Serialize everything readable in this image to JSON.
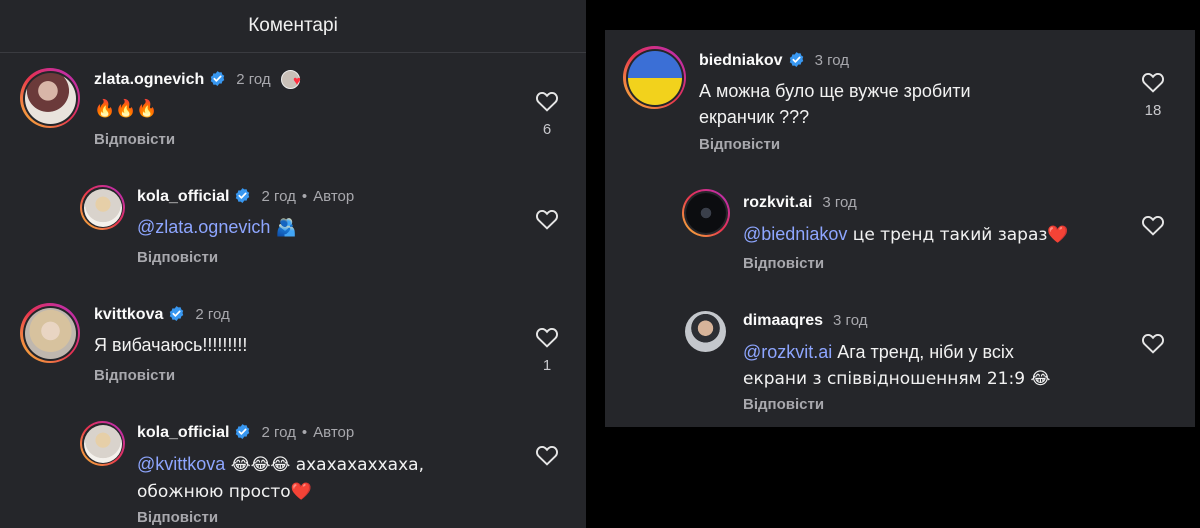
{
  "left": {
    "header_title": "Коментарі",
    "comments": [
      {
        "user": "zlata.ognevich",
        "time": "2 год",
        "text": "🔥🔥🔥",
        "reply": "Відповісти",
        "likes": "6"
      },
      {
        "user": "kola_official",
        "time": "2 год",
        "author": "Автор",
        "mention": "@zlata.ognevich",
        "text": " 🫂",
        "reply": "Відповісти"
      },
      {
        "user": "kvittkova",
        "time": "2 год",
        "text": "Я вибачаюсь!!!!!!!!!",
        "reply": "Відповісти",
        "likes": "1"
      },
      {
        "user": "kola_official",
        "time": "2 год",
        "author": "Автор",
        "mention": "@kvittkova",
        "text": " 😂😂😂 ахахахаххаха,",
        "text2": "обожнюю просто❤️",
        "reply": "Відповісти"
      }
    ]
  },
  "right": {
    "comments": [
      {
        "user": "biedniakov",
        "time": "3 год",
        "text": "А можна було ще вужче зробити",
        "text2": "екранчик ???",
        "reply": "Відповісти",
        "likes": "18"
      },
      {
        "user": "rozkvit.ai",
        "time": "3 год",
        "mention": "@biedniakov",
        "text": " це тренд такий зараз❤️",
        "reply": "Відповісти"
      },
      {
        "user": "dimaaqres",
        "time": "3 год",
        "mention": "@rozkvit.ai",
        "text": " Ага тренд, ніби у всіх",
        "text2": "екрани з співвідношенням 21:9 😂",
        "reply": "Відповісти"
      }
    ]
  },
  "colors": {
    "panel": "#25262a",
    "mention": "#8ea6ff",
    "verified": "#3897f0",
    "muted": "#a8a8ad"
  }
}
